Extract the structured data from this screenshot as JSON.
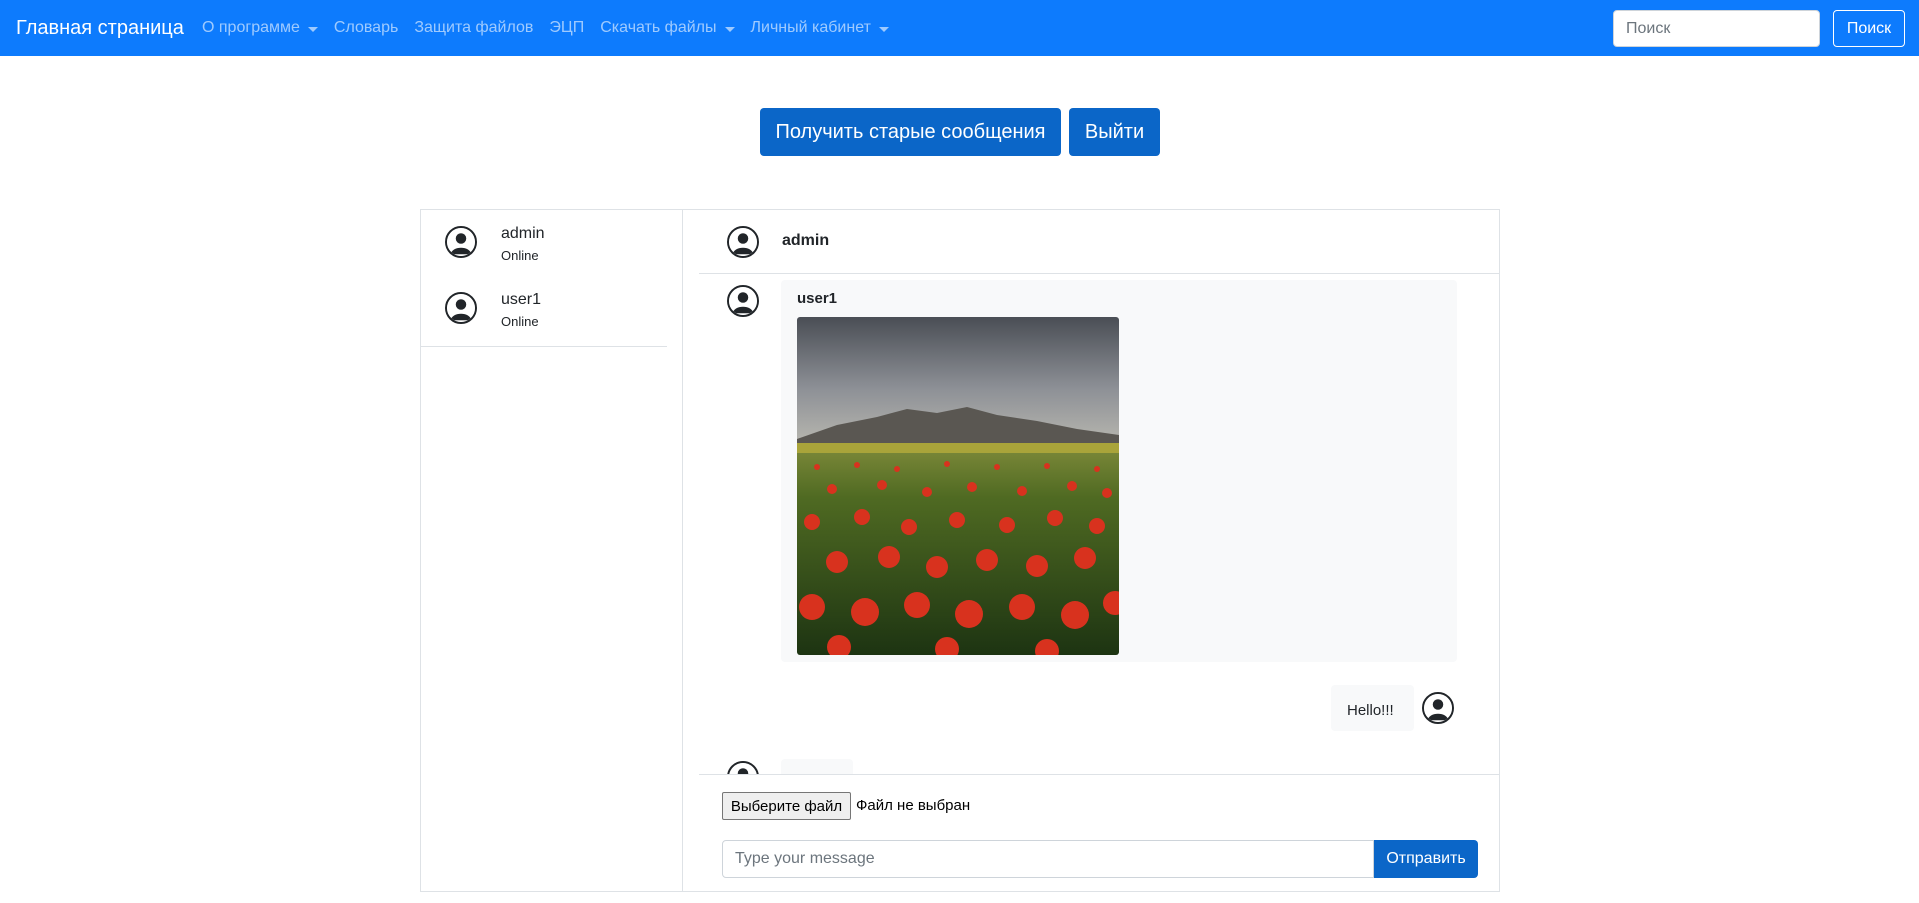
{
  "navbar": {
    "brand": "Главная страница",
    "links": [
      {
        "label": "О программе",
        "dropdown": true
      },
      {
        "label": "Словарь",
        "dropdown": false
      },
      {
        "label": "Защита файлов",
        "dropdown": false
      },
      {
        "label": "ЭЦП",
        "dropdown": false
      },
      {
        "label": "Скачать файлы",
        "dropdown": true
      },
      {
        "label": "Личный кабинет",
        "dropdown": true
      }
    ],
    "search_placeholder": "Поиск",
    "search_button": "Поиск"
  },
  "actions": {
    "old_messages": "Получить старые сообщения",
    "logout": "Выйти"
  },
  "users": [
    {
      "name": "admin",
      "status": "Online"
    },
    {
      "name": "user1",
      "status": "Online"
    }
  ],
  "conversation": {
    "title": "admin",
    "messages": [
      {
        "author": "user1",
        "type": "image",
        "image_desc": "red poppy field with mountains"
      },
      {
        "type": "text",
        "text": "Hello!!!",
        "side": "right"
      }
    ]
  },
  "composer": {
    "file_button": "Выберите файл",
    "file_status": "Файл не выбран",
    "message_placeholder": "Type your message",
    "send_button": "Отправить"
  },
  "colors": {
    "navbar": "#0d7bfd",
    "primary_button": "#0b66c8",
    "bubble": "#f8f9fa"
  }
}
